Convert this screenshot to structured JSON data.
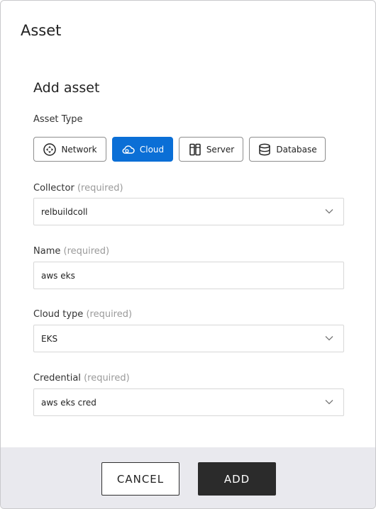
{
  "dialog": {
    "title": "Asset"
  },
  "form": {
    "section_title": "Add asset",
    "asset_type_label": "Asset Type",
    "asset_types": [
      {
        "label": "Network",
        "icon": "network-icon",
        "selected": false
      },
      {
        "label": "Cloud",
        "icon": "cloud-icon",
        "selected": true
      },
      {
        "label": "Server",
        "icon": "server-icon",
        "selected": false
      },
      {
        "label": "Database",
        "icon": "database-icon",
        "selected": false
      }
    ],
    "required_text": "(required)",
    "collector": {
      "label": "Collector",
      "value": "relbuildcoll"
    },
    "name": {
      "label": "Name",
      "value": "aws eks"
    },
    "cloud_type": {
      "label": "Cloud type",
      "value": "EKS"
    },
    "credential": {
      "label": "Credential",
      "value": "aws eks cred"
    }
  },
  "footer": {
    "cancel_label": "CANCEL",
    "add_label": "ADD"
  },
  "colors": {
    "accent": "#0b6fd6",
    "primary_button": "#2b2b2b",
    "footer_bg": "#e9e9ee"
  }
}
